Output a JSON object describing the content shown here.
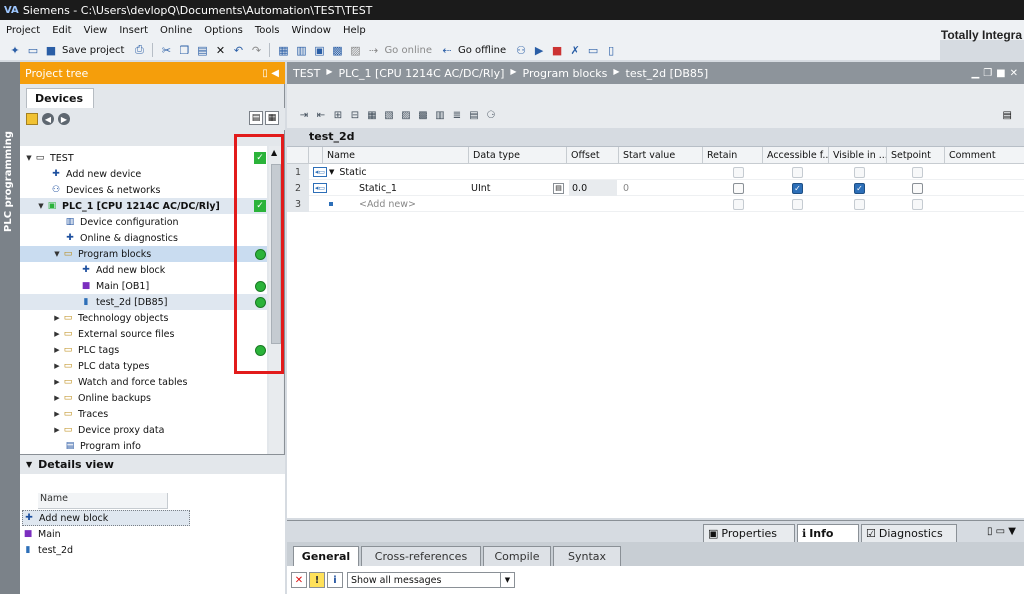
{
  "window": {
    "title": "Siemens  -  C:\\Users\\devlopQ\\Documents\\Automation\\TEST\\TEST",
    "logo": "VA"
  },
  "menu": [
    "Project",
    "Edit",
    "View",
    "Insert",
    "Online",
    "Options",
    "Tools",
    "Window",
    "Help"
  ],
  "brand": "Totally Integra",
  "toolbar": {
    "save_label": "Save project",
    "go_online": "Go online",
    "go_offline": "Go offline"
  },
  "sidebar_tab": "PLC programming",
  "project_tree": {
    "title": "Project tree",
    "devices_tab": "Devices",
    "items": [
      {
        "label": "TEST",
        "status": "check"
      },
      {
        "label": "Add new device",
        "status": ""
      },
      {
        "label": "Devices & networks",
        "status": ""
      },
      {
        "label": "PLC_1 [CPU 1214C AC/DC/Rly]",
        "status": "check"
      },
      {
        "label": "Device configuration",
        "status": ""
      },
      {
        "label": "Online & diagnostics",
        "status": ""
      },
      {
        "label": "Program blocks",
        "status": "green"
      },
      {
        "label": "Add new block",
        "status": ""
      },
      {
        "label": "Main [OB1]",
        "status": "green"
      },
      {
        "label": "test_2d [DB85]",
        "status": "green"
      },
      {
        "label": "Technology objects",
        "status": ""
      },
      {
        "label": "External source files",
        "status": ""
      },
      {
        "label": "PLC tags",
        "status": "green"
      },
      {
        "label": "PLC data types",
        "status": ""
      },
      {
        "label": "Watch and force tables",
        "status": ""
      },
      {
        "label": "Online backups",
        "status": ""
      },
      {
        "label": "Traces",
        "status": ""
      },
      {
        "label": "Device proxy data",
        "status": ""
      },
      {
        "label": "Program info",
        "status": ""
      }
    ]
  },
  "details_view": {
    "title": "Details view",
    "column": "Name",
    "items": [
      "Add new block",
      "Main",
      "test_2d"
    ]
  },
  "editor": {
    "breadcrumb": [
      "TEST",
      "PLC_1 [CPU 1214C AC/DC/Rly]",
      "Program blocks",
      "test_2d [DB85]"
    ],
    "block_title": "test_2d",
    "columns": [
      "Name",
      "Data type",
      "Offset",
      "Start value",
      "Retain",
      "Accessible f...",
      "Visible in ...",
      "Setpoint",
      "Comment"
    ],
    "rows": [
      {
        "num": "1",
        "name": "Static",
        "type": "",
        "offset": "",
        "start": "",
        "retain": false,
        "accessible": false,
        "visible": false,
        "setpoint": false
      },
      {
        "num": "2",
        "name": "Static_1",
        "type": "UInt",
        "offset": "0.0",
        "start": "0",
        "retain": false,
        "accessible": true,
        "visible": true,
        "setpoint": false
      },
      {
        "num": "3",
        "name": "<Add new>",
        "type": "",
        "offset": "",
        "start": "",
        "retain": false,
        "accessible": false,
        "visible": false,
        "setpoint": false
      }
    ]
  },
  "inspector": {
    "tabs": [
      "Properties",
      "Info",
      "Diagnostics"
    ],
    "subtabs": [
      "General",
      "Cross-references",
      "Compile",
      "Syntax"
    ],
    "filter": "Show all messages"
  }
}
